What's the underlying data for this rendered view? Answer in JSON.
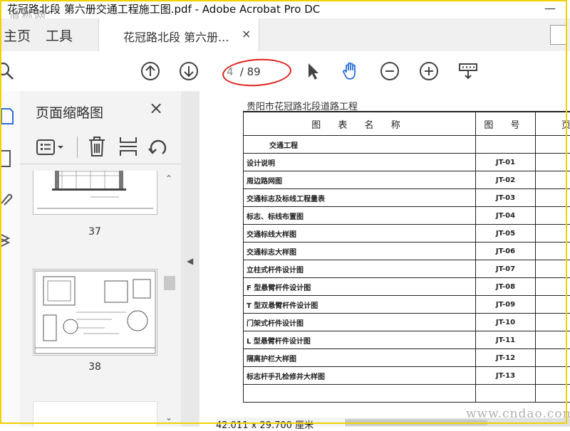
{
  "window": {
    "title": "花冠路北段 第六册交通工程施工图.pdf - Adobe Acrobat Pro DC",
    "minimize": "—",
    "watermark_top": "道称网"
  },
  "tabs": {
    "home": "主页",
    "tools": "工具",
    "document": "花冠路北段 第六册...",
    "close": "×"
  },
  "toolbar": {
    "current_page": "4",
    "page_total": "/ 89",
    "icons": [
      "zoom-icon",
      "prev-page-icon",
      "next-page-icon",
      "select-cursor-icon",
      "hand-tool-icon",
      "zoom-out-icon",
      "zoom-in-icon",
      "print-tool-icon"
    ],
    "hand_color": "#2a6fdb"
  },
  "sidebar": {
    "title": "页面缩略图",
    "close": "×",
    "tools": [
      "options-icon",
      "delete-page-icon",
      "insert-page-icon",
      "rotate-page-icon"
    ],
    "thumbnails": [
      {
        "label": "37"
      },
      {
        "label": "38"
      },
      {
        "label": ""
      }
    ]
  },
  "document": {
    "project": "贵阳市花冠路北段道路工程",
    "header": {
      "name": "图 表 名 称",
      "code": "图 号",
      "pages": "页"
    },
    "section": "交通工程",
    "rows": [
      {
        "name": "设计说明",
        "code": "JT-01"
      },
      {
        "name": "周边路网图",
        "code": "JT-02"
      },
      {
        "name": "交通标志及标线工程量表",
        "code": "JT-03"
      },
      {
        "name": "标志、标线布置图",
        "code": "JT-04"
      },
      {
        "name": "交通标线大样图",
        "code": "JT-05"
      },
      {
        "name": "交通标志大样图",
        "code": "JT-06"
      },
      {
        "name": "立柱式杆件设计图",
        "code": "JT-07"
      },
      {
        "name": "F 型悬臂杆件设计图",
        "code": "JT-08"
      },
      {
        "name": "T 型双悬臂杆件设计图",
        "code": "JT-09"
      },
      {
        "name": "门架式杆件设计图",
        "code": "JT-10"
      },
      {
        "name": "L 型悬臂杆件设计图",
        "code": "JT-11"
      },
      {
        "name": "隔离护栏大样图",
        "code": "JT-12"
      },
      {
        "name": "标志杆手孔检修井大样图",
        "code": "JT-13"
      },
      {
        "name": "",
        "code": ""
      }
    ],
    "page_size": "42.011 x 29.700 厘米"
  },
  "watermark_bottom": "www.cndao.com",
  "colors": {
    "highlight_circle": "#e0201a",
    "frame": "#f2d100"
  }
}
